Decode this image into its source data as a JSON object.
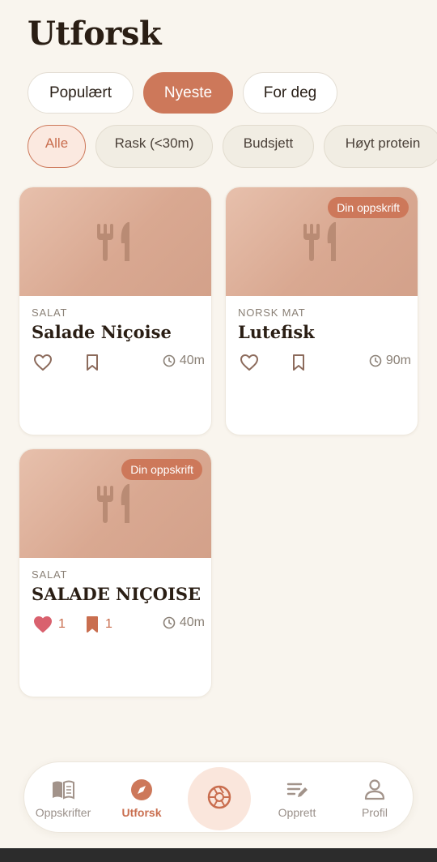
{
  "header": {
    "title": "Utforsk"
  },
  "sort_tabs": [
    {
      "label": "Populært",
      "active": false
    },
    {
      "label": "Nyeste",
      "active": true
    },
    {
      "label": "For deg",
      "active": false
    }
  ],
  "filter_chips": [
    {
      "label": "Alle",
      "active": true
    },
    {
      "label": "Rask (<30m)",
      "active": false
    },
    {
      "label": "Budsjett",
      "active": false
    },
    {
      "label": "Høyt protein",
      "active": false
    }
  ],
  "recipes": [
    {
      "category": "SALAT",
      "title": "Salade Niçoise",
      "badge": "",
      "time": "40m",
      "liked": false,
      "likes": "",
      "saved": false,
      "saves": ""
    },
    {
      "category": "NORSK MAT",
      "title": "Lutefisk",
      "badge": "Din oppskrift",
      "time": "90m",
      "liked": false,
      "likes": "",
      "saved": false,
      "saves": ""
    },
    {
      "category": "SALAT",
      "title": "SALADE NIÇOISE",
      "badge": "Din oppskrift",
      "time": "40m",
      "liked": true,
      "likes": "1",
      "saved": true,
      "saves": "1"
    }
  ],
  "bottom_nav": {
    "items": [
      {
        "label": "Oppskrifter",
        "icon": "book-icon",
        "active": false
      },
      {
        "label": "Utforsk",
        "icon": "compass-icon",
        "active": true
      },
      {
        "label": "Opprett",
        "icon": "edit-list-icon",
        "active": false
      },
      {
        "label": "Profil",
        "icon": "user-icon",
        "active": false
      }
    ],
    "center_icon": "camera-aperture-icon"
  },
  "colors": {
    "accent": "#cd785a",
    "background": "#f9f5ee",
    "heart_filled": "#d9616e",
    "card_image": "#dcae97"
  }
}
